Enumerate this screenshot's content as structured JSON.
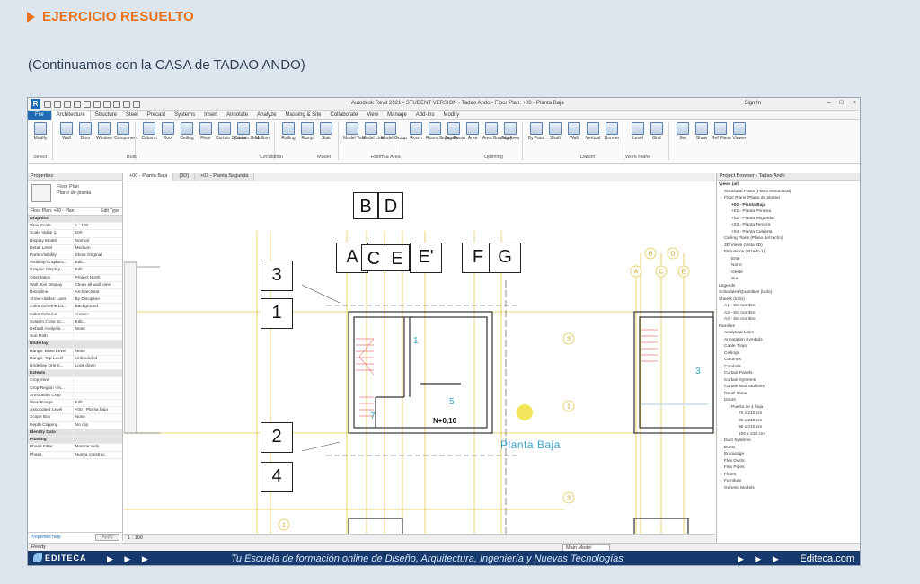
{
  "heading": "EJERCICIO RESUELTO",
  "subtitle": "(Continuamos con la CASA de TADAO ANDO)",
  "revit": {
    "logo": "R",
    "title": "Autodesk Revit 2021 - STUDENT VERSION - Tadao Ando - Floor Plan: +00 - Planta Baja",
    "signin": "Sign In",
    "tabs": [
      "File",
      "Architecture",
      "Structure",
      "Steel",
      "Precast",
      "Systems",
      "Insert",
      "Annotate",
      "Analyze",
      "Massing & Site",
      "Collaborate",
      "View",
      "Manage",
      "Add-Ins",
      "Modify"
    ],
    "ribbon_buttons": [
      "Modify",
      "Wall",
      "Door",
      "Window",
      "Component",
      "Column",
      "Roof",
      "Ceiling",
      "Floor",
      "Curtain System",
      "Curtain Grid",
      "Mullion",
      "Railing",
      "Ramp",
      "Stair",
      "Model Text",
      "Model Line",
      "Model Group",
      "Room",
      "Room Separator",
      "Tag Room",
      "Area",
      "Area Boundary",
      "Tag Area",
      "By Face",
      "Shaft",
      "Wall",
      "Vertical",
      "Dormer",
      "Level",
      "Grid",
      "Set",
      "Show",
      "Ref Plane",
      "Viewer"
    ],
    "ribbon_panels": [
      "Select",
      "Build",
      "Circulation",
      "Model",
      "Room & Area",
      "Opening",
      "Datum",
      "Work Plane"
    ],
    "properties": {
      "title": "Properties",
      "type_name": "Floor Plan",
      "type_sub": "Plano de planta",
      "instance": "Floor Plan: +00 - Plan",
      "edit_type": "Edit Type",
      "rows": [
        [
          "Graphics",
          ""
        ],
        [
          "View Scale",
          "1 : 100"
        ],
        [
          "Scale Value 1:",
          "100"
        ],
        [
          "Display Model",
          "Normal"
        ],
        [
          "Detail Level",
          "Medium"
        ],
        [
          "Parts Visibility",
          "Show Original"
        ],
        [
          "Visibility/Graphics...",
          "Edit..."
        ],
        [
          "Graphic Display...",
          "Edit..."
        ],
        [
          "Orientation",
          "Project North"
        ],
        [
          "Wall Join Display",
          "Clean all wall joins"
        ],
        [
          "Discipline",
          "Architectural"
        ],
        [
          "Show Hidden Lines",
          "By Discipline"
        ],
        [
          "Color Scheme Lo...",
          "Background"
        ],
        [
          "Color Scheme",
          "<none>"
        ],
        [
          "System Color Sc...",
          "Edit..."
        ],
        [
          "Default Analysis...",
          "None"
        ],
        [
          "Sun Path",
          ""
        ],
        [
          "Underlay",
          ""
        ],
        [
          "Range: Base Level",
          "None"
        ],
        [
          "Range: Top Level",
          "Unbounded"
        ],
        [
          "Underlay Orient...",
          "Look down"
        ],
        [
          "Extents",
          ""
        ],
        [
          "Crop View",
          ""
        ],
        [
          "Crop Region Vis...",
          ""
        ],
        [
          "Annotation Crop",
          ""
        ],
        [
          "View Range",
          "Edit..."
        ],
        [
          "Associated Level",
          "+00 - Planta baja"
        ],
        [
          "Scope Box",
          "None"
        ],
        [
          "Depth Clipping",
          "No clip"
        ],
        [
          "Identity Data",
          ""
        ],
        [
          "Phasing",
          ""
        ],
        [
          "Phase Filter",
          "Mostrar todo"
        ],
        [
          "Phase",
          "Nueva construc"
        ]
      ],
      "help": "Properties help",
      "apply": "Apply"
    },
    "view_tabs": [
      "+00 - Planta Baja",
      "{3D}",
      "+02 - Planta Segunda"
    ],
    "grids_top": [
      "B",
      "D"
    ],
    "grids_mid": [
      "A",
      "C",
      "E",
      "E'",
      "F",
      "G"
    ],
    "levels": [
      "3",
      "1",
      "2",
      "4"
    ],
    "room_numbers": [
      "1",
      "5",
      "7",
      "3"
    ],
    "level_tag": "N+0,10",
    "view_name": "Planta Baja",
    "canvas_bubbles": [
      "B",
      "D",
      "A",
      "C",
      "E",
      "3",
      "1",
      "2",
      "4",
      "1",
      "3"
    ],
    "scale": "1 : 100",
    "browser": {
      "title": "Project Browser - Tadao Ando",
      "items": [
        {
          "t": "Views (all)",
          "l": 0,
          "b": true
        },
        {
          "t": "Structural Plans (Plano estructural)",
          "l": 1
        },
        {
          "t": "Floor Plans (Plano de planta)",
          "l": 1
        },
        {
          "t": "+00 - Planta Baja",
          "l": 2,
          "b": true
        },
        {
          "t": "+01 - Planta Primera",
          "l": 2
        },
        {
          "t": "+02 - Planta Segunda",
          "l": 2
        },
        {
          "t": "+03 - Planta Tercera",
          "l": 2
        },
        {
          "t": "+04 - Planta Cubierta",
          "l": 2
        },
        {
          "t": "Ceiling Plans (Plano del techo)",
          "l": 1
        },
        {
          "t": "3D Views (Vista 3D)",
          "l": 1
        },
        {
          "t": "Elevations (Alzado 1)",
          "l": 1
        },
        {
          "t": "Este",
          "l": 2
        },
        {
          "t": "Norte",
          "l": 2
        },
        {
          "t": "Oeste",
          "l": 2
        },
        {
          "t": "Sur",
          "l": 2
        },
        {
          "t": "Legends",
          "l": 0
        },
        {
          "t": "Schedules/Quantities (todo)",
          "l": 0
        },
        {
          "t": "Sheets (todo)",
          "l": 0
        },
        {
          "t": "A1 - Sin nombre",
          "l": 1
        },
        {
          "t": "A2 - Sin nombre",
          "l": 1
        },
        {
          "t": "A3 - Sin nombre",
          "l": 1
        },
        {
          "t": "Families",
          "l": 0
        },
        {
          "t": "Analytical Links",
          "l": 1
        },
        {
          "t": "Annotation Symbols",
          "l": 1
        },
        {
          "t": "Cable Trays",
          "l": 1
        },
        {
          "t": "Ceilings",
          "l": 1
        },
        {
          "t": "Columns",
          "l": 1
        },
        {
          "t": "Conduits",
          "l": 1
        },
        {
          "t": "Curtain Panels",
          "l": 1
        },
        {
          "t": "Curtain Systems",
          "l": 1
        },
        {
          "t": "Curtain Wall Mullions",
          "l": 1
        },
        {
          "t": "Detail Items",
          "l": 1
        },
        {
          "t": "Doors",
          "l": 1
        },
        {
          "t": "Puerta de 1 hoja",
          "l": 2
        },
        {
          "t": "70 x 210 cm",
          "l": 3
        },
        {
          "t": "80 x 210 cm",
          "l": 3
        },
        {
          "t": "90 x 210 cm",
          "l": 3
        },
        {
          "t": "100 x 210 cm",
          "l": 3
        },
        {
          "t": "Duct Systems",
          "l": 1
        },
        {
          "t": "Ducts",
          "l": 1
        },
        {
          "t": "Entourage",
          "l": 1
        },
        {
          "t": "Flex Ducts",
          "l": 1
        },
        {
          "t": "Flex Pipes",
          "l": 1
        },
        {
          "t": "Floors",
          "l": 1
        },
        {
          "t": "Furniture",
          "l": 1
        },
        {
          "t": "Generic Models",
          "l": 1
        }
      ]
    },
    "status": "Ready",
    "model": "Main Model"
  },
  "footer": {
    "brand": "EDITECA",
    "arrows": "▶ ▶ ▶",
    "slogan": "Tu Escuela de formación online de Diseño, Arquitectura, Ingeniería y Nuevas Tecnologías",
    "site": "Editeca.com"
  },
  "colors": {
    "accent": "#e8731c",
    "revit_blue": "#1f6bb6",
    "footer": "#163a6e",
    "grid_yellow": "#e6c74a",
    "room_cyan": "#2fa4c4"
  }
}
